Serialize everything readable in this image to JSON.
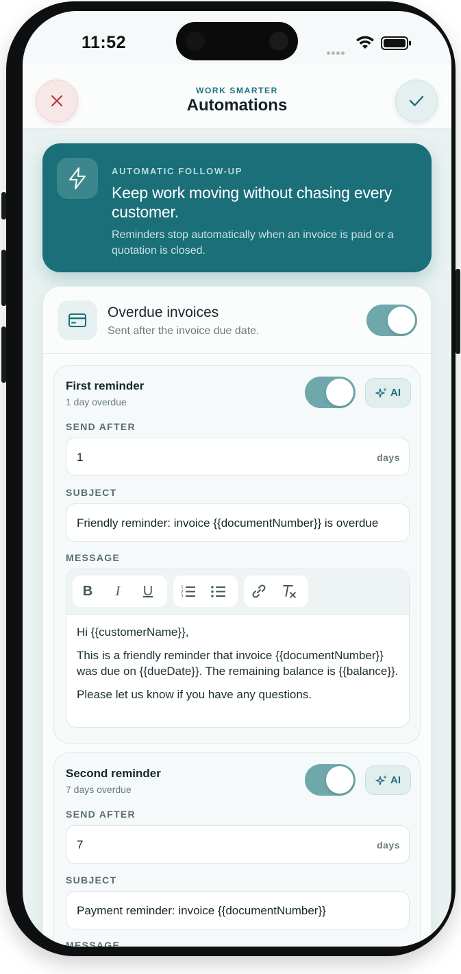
{
  "status_bar": {
    "time": "11:52"
  },
  "header": {
    "eyebrow": "WORK SMARTER",
    "title": "Automations"
  },
  "hero": {
    "eyebrow": "AUTOMATIC FOLLOW-UP",
    "title": "Keep work moving without chasing every customer.",
    "description": "Reminders stop automatically when an invoice is paid or a quotation is closed."
  },
  "overdue": {
    "title": "Overdue invoices",
    "subtitle": "Sent after the invoice due date.",
    "enabled": true
  },
  "reminders": [
    {
      "title": "First reminder",
      "subtitle": "1 day overdue",
      "enabled": true,
      "ai_label": "AI",
      "send_after_label": "SEND AFTER",
      "send_after_value": "1",
      "send_after_unit": "days",
      "subject_label": "SUBJECT",
      "subject_value": "Friendly reminder: invoice {{documentNumber}} is overdue",
      "message_label": "MESSAGE",
      "message": {
        "line1": "Hi {{customerName}},",
        "line2": "This is a friendly reminder that invoice {{documentNumber}} was due on {{dueDate}}. The remaining balance is {{balance}}.",
        "line3": "Please let us know if you have any questions."
      }
    },
    {
      "title": "Second reminder",
      "subtitle": "7 days overdue",
      "enabled": true,
      "ai_label": "AI",
      "send_after_label": "SEND AFTER",
      "send_after_value": "7",
      "send_after_unit": "days",
      "subject_label": "SUBJECT",
      "subject_value": "Payment reminder: invoice {{documentNumber}}",
      "message_label": "MESSAGE"
    }
  ],
  "toolbar": {
    "bold": "B",
    "italic": "I",
    "underline": "U"
  },
  "colors": {
    "accent": "#1a6f79",
    "toggle_on": "#6ea8ab",
    "close": "#b0303a"
  }
}
